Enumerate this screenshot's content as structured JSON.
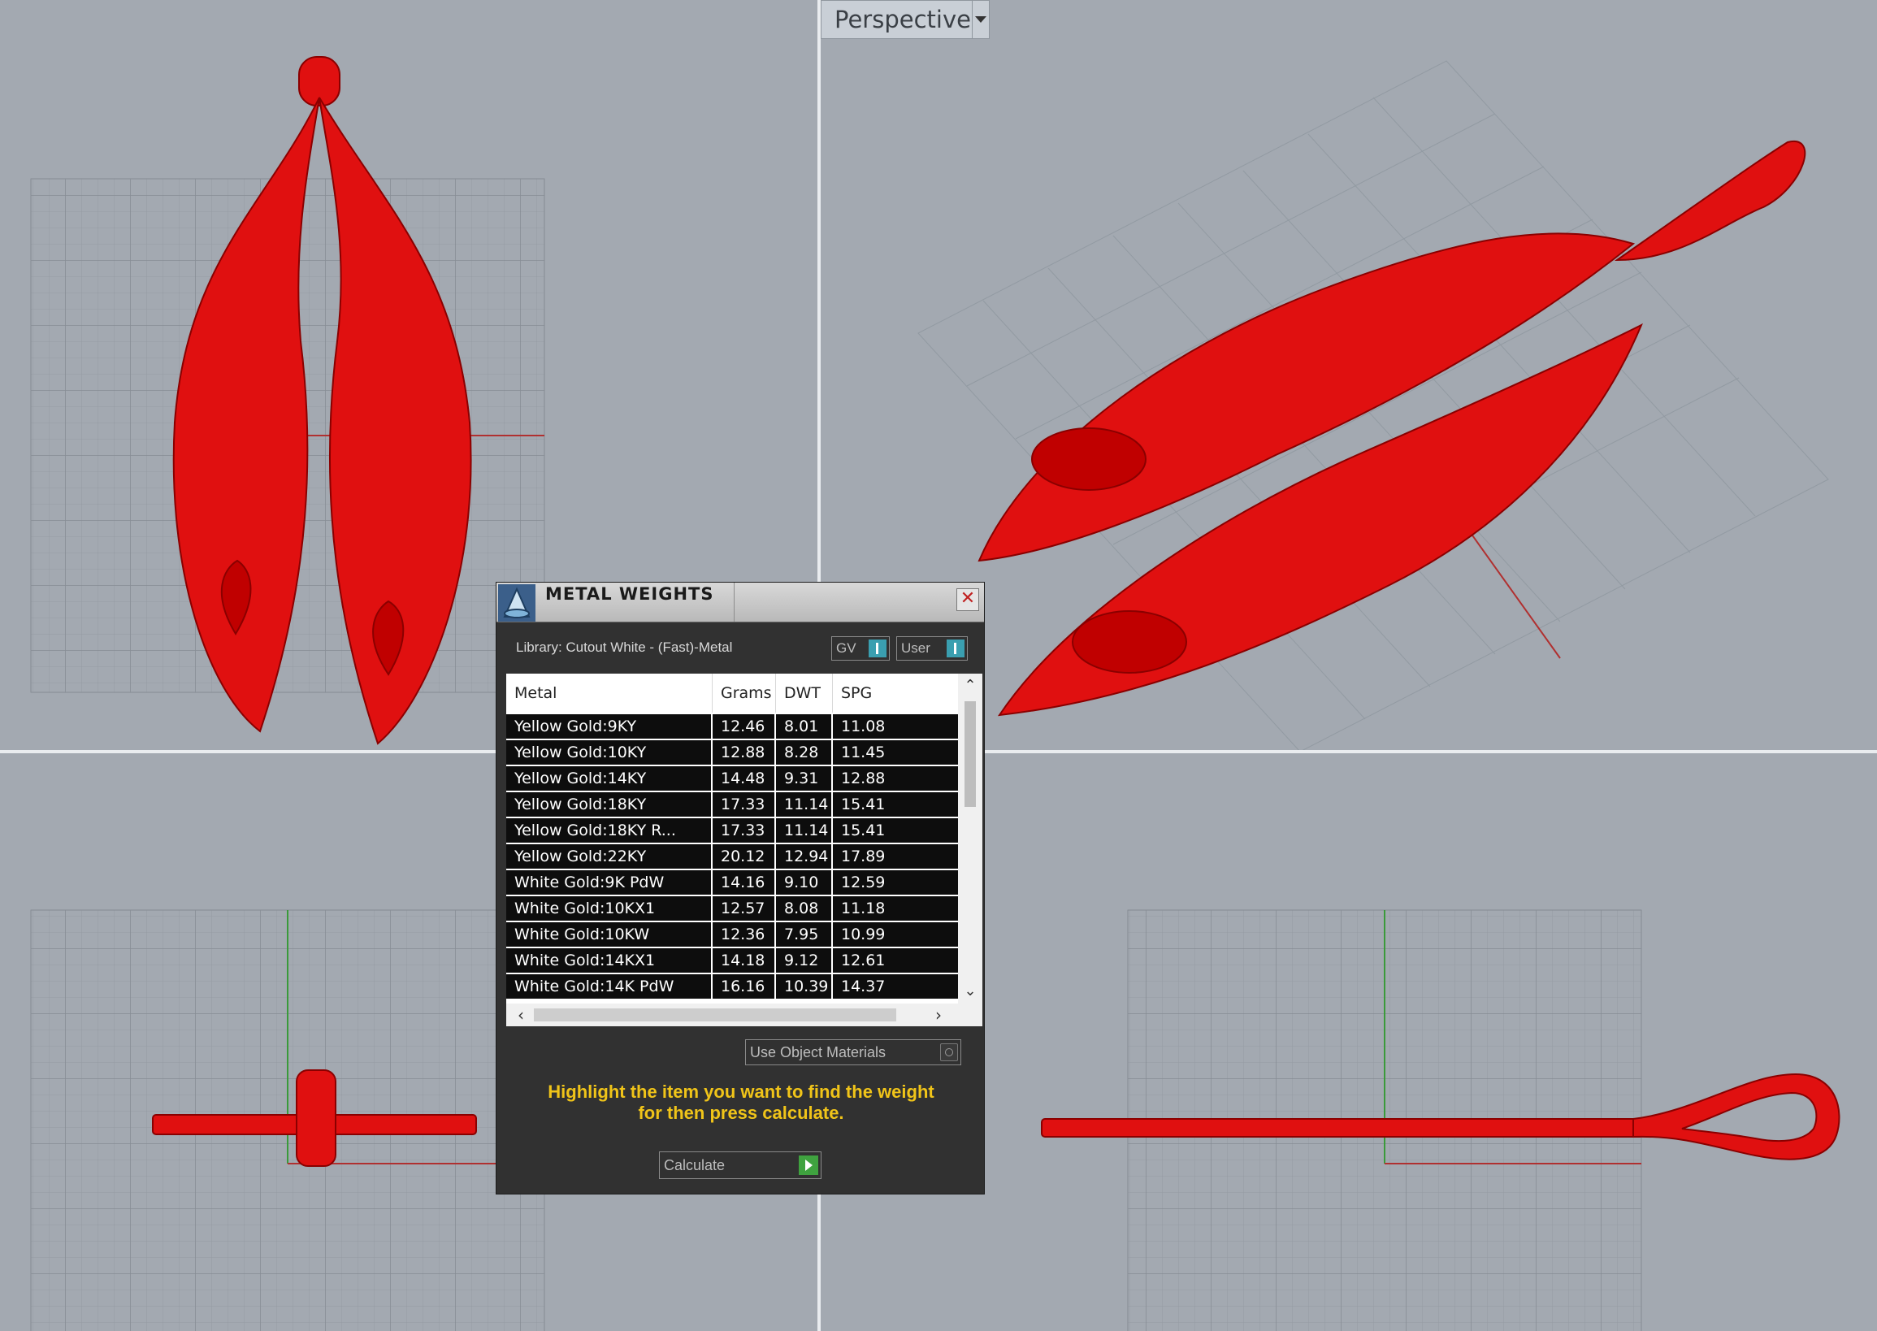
{
  "viewport": {
    "label": "Perspective"
  },
  "dialog": {
    "title": "METAL WEIGHTS",
    "library": "Library: Cutout White - (Fast)-Metal",
    "toggle_gv": "GV",
    "toggle_user": "User",
    "columns": [
      "Metal",
      "Grams",
      "DWT",
      "SPG"
    ],
    "rows": [
      {
        "metal": "Yellow Gold:9KY",
        "grams": "12.46",
        "dwt": "8.01",
        "spg": "11.08"
      },
      {
        "metal": "Yellow Gold:10KY",
        "grams": "12.88",
        "dwt": "8.28",
        "spg": "11.45"
      },
      {
        "metal": "Yellow Gold:14KY",
        "grams": "14.48",
        "dwt": "9.31",
        "spg": "12.88"
      },
      {
        "metal": "Yellow Gold:18KY",
        "grams": "17.33",
        "dwt": "11.14",
        "spg": "15.41"
      },
      {
        "metal": "Yellow Gold:18KY R...",
        "grams": "17.33",
        "dwt": "11.14",
        "spg": "15.41"
      },
      {
        "metal": "Yellow Gold:22KY",
        "grams": "20.12",
        "dwt": "12.94",
        "spg": "17.89"
      },
      {
        "metal": "White Gold:9K PdW",
        "grams": "14.16",
        "dwt": "9.10",
        "spg": "12.59"
      },
      {
        "metal": "White Gold:10KX1",
        "grams": "12.57",
        "dwt": "8.08",
        "spg": "11.18"
      },
      {
        "metal": "White Gold:10KW",
        "grams": "12.36",
        "dwt": "7.95",
        "spg": "10.99"
      },
      {
        "metal": "White Gold:14KX1",
        "grams": "14.18",
        "dwt": "9.12",
        "spg": "12.61"
      },
      {
        "metal": "White Gold:14K PdW",
        "grams": "16.16",
        "dwt": "10.39",
        "spg": "14.37"
      }
    ],
    "use_object_materials": "Use Object Materials",
    "hint_line1": "Highlight the item you want to find the weight",
    "hint_line2": "for then press calculate.",
    "calculate": "Calculate"
  },
  "colors": {
    "model": "#e01010",
    "viewport_bg": "#a3a9b1",
    "grid": "#8d939b",
    "hint": "#f0c419"
  }
}
